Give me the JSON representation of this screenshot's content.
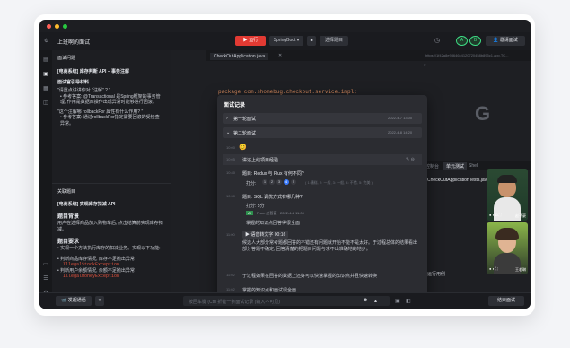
{
  "window": {
    "title": "上班啊的面试",
    "colors": {
      "red": "#ff5f57",
      "yellow": "#febc2e",
      "green": "#28c840"
    }
  },
  "toolbar": {
    "run_label": "运行",
    "framework": "SpringBoot",
    "choose_label": "选择题目",
    "invite_label": "邀请面试",
    "avatar_a": "A",
    "avatar_b": "B"
  },
  "sidebar": {
    "icons": [
      "file-icon",
      "book-icon",
      "grid-icon",
      "chat-icon",
      "list-icon",
      "settings-icon"
    ]
  },
  "left": {
    "section_title": "面试问题",
    "q_title": "[电商系统] 库存判断 API – 事务注解",
    "sub_title": "面试官引导材料",
    "p1": "\"请重点讲讲你对 \"注解\" ? \"",
    "p2": "• 参考答案: @Transactional 是Spring框架的事务管理, 作用是数据库操作出现异常时能够进行回滚。",
    "p3": "\"这个注解哪 rollbackFor 属性有什么作用? \"",
    "p4": "• 参考答案: 通过rollbackFor指定需要回滚的受检查异常。",
    "section2": "关联题目",
    "q2_title": "[电商系统] 实现库存扣减 API",
    "h_bg": "题目背景",
    "bg_text": "用户在选择商品加入购物车后, 点击结算前实现库存扣减。",
    "h_req": "题目要求",
    "req_text": "• 实现一个方法执行库存的扣减业务。实现以下功能:",
    "b1": "• 判断商品库存情况, 库存不足抛出异常",
    "code1": "IllegalStockException",
    "b2": "• 判断用户余额情况, 余额不足抛出异常",
    "code2": "IllegalMoneyException"
  },
  "editor": {
    "tab": "CheckOutApplication.java",
    "url": "https://1f42a8e98646c4120720458b895c1.app.TC...",
    "code_line": "package com.shomebug.checkout.service.impl;",
    "right_tabs": [
      "控制台",
      "单元测试",
      "Shell"
    ],
    "test_file": "CheckOutApplicationTests.java",
    "running": "运行用例"
  },
  "modal": {
    "title": "面试记录",
    "round1": "第一轮面试",
    "round1_time": "2022-4-7 13:00",
    "round2": "第二轮面试",
    "round2_time": "2022-4-8 14:20",
    "time1": "10:00",
    "emoji": "😊",
    "time2": "10:05",
    "item2": "讲述上线项目经验",
    "time3": "10:40",
    "item3": "题目: Redux 与 Flux 有何不同?",
    "score_label": "打分:",
    "scores": [
      "1",
      "2",
      "3",
      "4",
      "5"
    ],
    "score_hint": "( 1:糟糕, 2: 一般, 3: 一般, 4: 不错, 5: 完美 )",
    "time4": "10:50",
    "item4": "题目: SQL 调优方式有哪几种?",
    "score_value": "打分: 5分",
    "ai_tag": "AI",
    "ai_source": "From 赵哲豪 · 2022-4-8 11:00",
    "ai_text": "掌握的知识点回答得很全面",
    "time5": "11:00",
    "audio": "语音转文字 00:16",
    "long_text": "候选人大部分常考题都回答的不错还有问题就开始不能不是太好。于过程总体的结果看出部分答题不确定, 回答清楚的把题目问题与求不出准确地的地步。",
    "time6": "11:02",
    "item6": "于过程如果在回答的数据上还好可以快速掌握的知识点并且快速转换",
    "time7": "11:02",
    "item7": "掌握的知识点和面试很全面"
  },
  "video": {
    "name1": "赵子豪",
    "name2": "王若琳"
  },
  "bottom": {
    "send_label": "发起通话",
    "chat_placeholder": "按回车键 (Ctrl 折键一条面试记录 (输入不可见)",
    "end_label": "结束面试"
  }
}
